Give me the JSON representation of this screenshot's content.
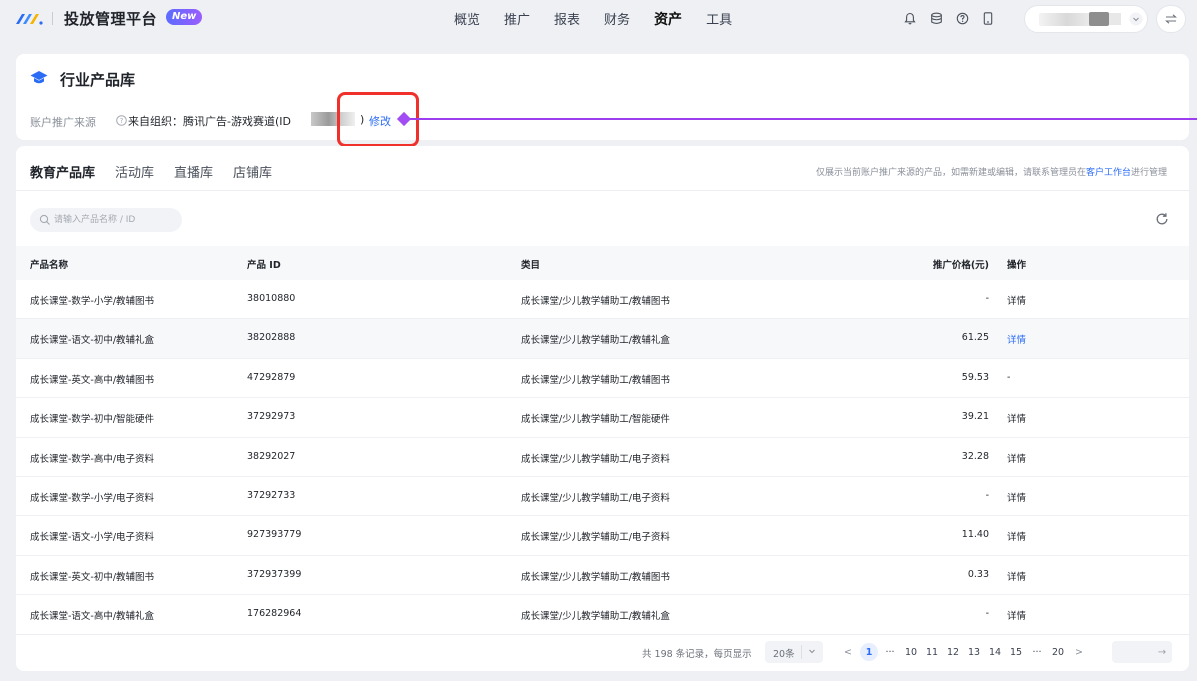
{
  "header": {
    "app_title": "投放管理平台",
    "new_badge": "New",
    "nav": [
      {
        "label": "概览",
        "active": false
      },
      {
        "label": "推广",
        "active": false
      },
      {
        "label": "报表",
        "active": false
      },
      {
        "label": "财务",
        "active": false
      },
      {
        "label": "资产",
        "active": true
      },
      {
        "label": "工具",
        "active": false
      }
    ],
    "icons": [
      "bell-icon",
      "database-icon",
      "help-circle-icon",
      "mobile-icon"
    ],
    "account_switch_icon": "switch-icon"
  },
  "page": {
    "title": "行业产品库",
    "source_label": "账户推广来源",
    "source_text": "来自组织：腾讯广告-游戏赛道(ID",
    "source_close": ")",
    "edit_label": "修改"
  },
  "tabs": [
    {
      "label": "教育产品库",
      "active": true
    },
    {
      "label": "活动库",
      "active": false
    },
    {
      "label": "直播库",
      "active": false
    },
    {
      "label": "店铺库",
      "active": false
    }
  ],
  "notice": {
    "prefix": "仅展示当前账户推广来源的产品，如需新建或编辑，请联系管理员在",
    "link": "客户工作台",
    "suffix": "进行管理"
  },
  "search": {
    "placeholder": "请输入产品名称 / ID"
  },
  "table": {
    "headers": {
      "name": "产品名称",
      "id": "产品 ID",
      "category": "类目",
      "price": "推广价格(元)",
      "op": "操作"
    },
    "rows": [
      {
        "name": "成长课堂-数学-小学/教辅图书",
        "id": "38010880",
        "category": "成长课堂/少儿教学辅助工/教辅图书",
        "price": "-",
        "op": "详情"
      },
      {
        "name": "成长课堂-语文-初中/教辅礼盒",
        "id": "38202888",
        "category": "成长课堂/少儿教学辅助工/教辅礼盒",
        "price": "61.25",
        "op": "详情"
      },
      {
        "name": "成长课堂-英文-高中/教辅图书",
        "id": "47292879",
        "category": "成长课堂/少儿教学辅助工/教辅图书",
        "price": "59.53",
        "op": "-"
      },
      {
        "name": "成长课堂-数学-初中/智能硬件",
        "id": "37292973",
        "category": "成长课堂/少儿教学辅助工/智能硬件",
        "price": "39.21",
        "op": "详情"
      },
      {
        "name": "成长课堂-数学-高中/电子资料",
        "id": "38292027",
        "category": "成长课堂/少儿教学辅助工/电子资料",
        "price": "32.28",
        "op": "详情"
      },
      {
        "name": "成长课堂-数学-小学/电子资料",
        "id": "37292733",
        "category": "成长课堂/少儿教学辅助工/电子资料",
        "price": "-",
        "op": "详情"
      },
      {
        "name": "成长课堂-语文-小学/电子资料",
        "id": "927393779",
        "category": "成长课堂/少儿教学辅助工/电子资料",
        "price": "11.40",
        "op": "详情"
      },
      {
        "name": "成长课堂-英文-初中/教辅图书",
        "id": "372937399",
        "category": "成长课堂/少儿教学辅助工/教辅图书",
        "price": "0.33",
        "op": "详情"
      },
      {
        "name": "成长课堂-语文-高中/教辅礼盒",
        "id": "176282964",
        "category": "成长课堂/少儿教学辅助工/教辅礼盒",
        "price": "-",
        "op": "详情"
      }
    ]
  },
  "pagination": {
    "total_text": "共 198 条记录，每页显示",
    "page_size": "20条",
    "prev": "<",
    "next": ">",
    "pages": [
      "1",
      "···",
      "10",
      "11",
      "12",
      "13",
      "14",
      "15",
      "···",
      "20"
    ],
    "current": "1",
    "jump_icon": "→"
  },
  "colors": {
    "accent": "#2b6cf5",
    "highlight": "#f0302a",
    "pointer": "#9c3ef0"
  }
}
